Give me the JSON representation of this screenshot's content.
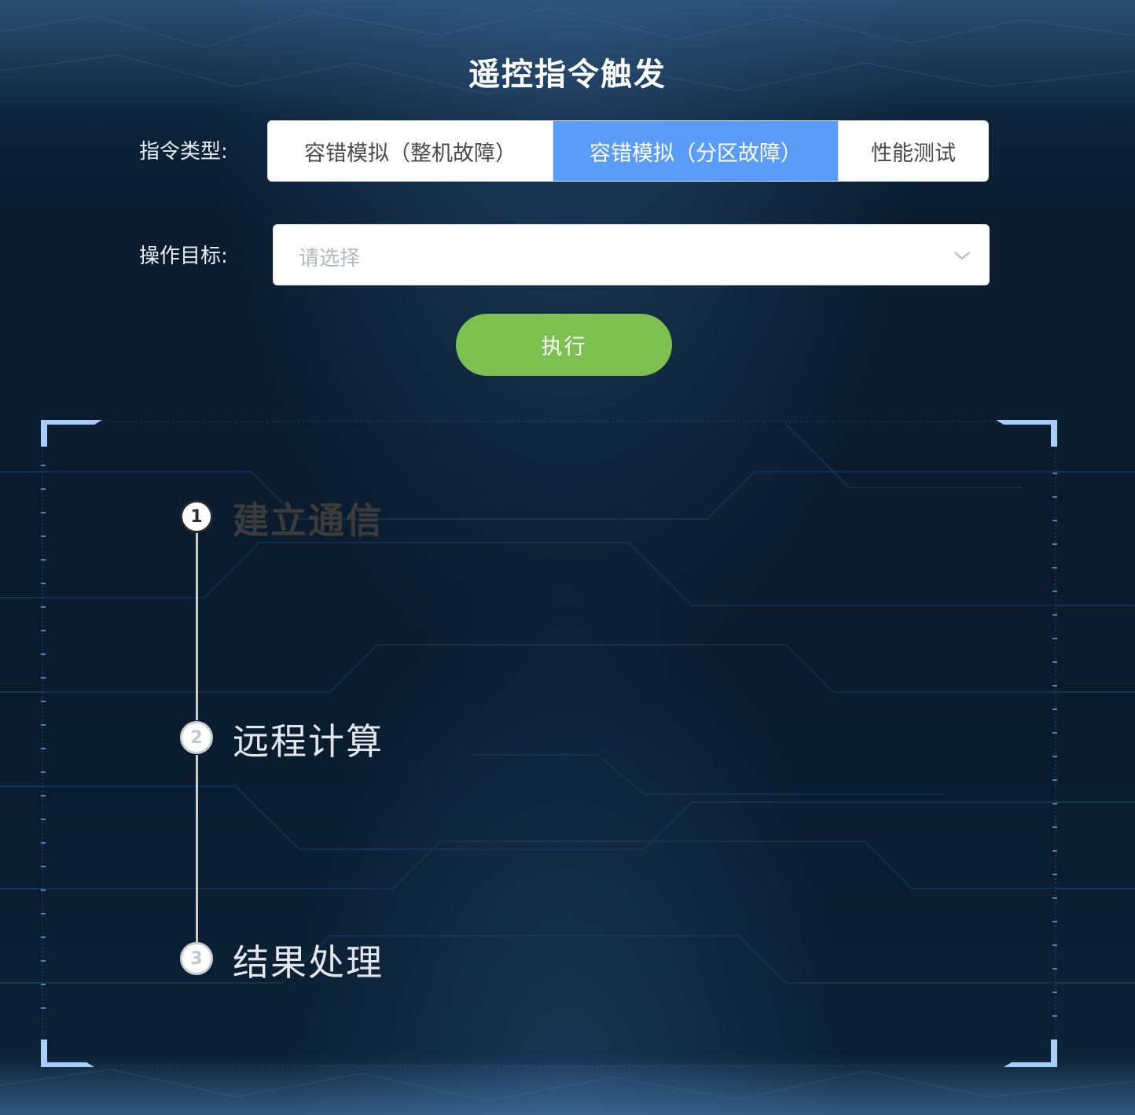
{
  "page": {
    "title": "遥控指令触发"
  },
  "form": {
    "command_type_label": "指令类型:",
    "command_types": [
      {
        "label": "容错模拟（整机故障）",
        "active": false
      },
      {
        "label": "容错模拟（分区故障）",
        "active": true
      },
      {
        "label": "性能测试",
        "active": false
      }
    ],
    "target_label": "操作目标:",
    "target_placeholder": "请选择",
    "target_value": "",
    "execute_label": "执行"
  },
  "steps": [
    {
      "number": "1",
      "title": "建立通信",
      "status": "done"
    },
    {
      "number": "2",
      "title": "远程计算",
      "status": "wait"
    },
    {
      "number": "3",
      "title": "结果处理",
      "status": "wait"
    }
  ],
  "colors": {
    "active_segment": "#5a9cf8",
    "execute_button": "#7cc14f",
    "frame_accent": "#6aa8ff",
    "background": "#0a1b2c"
  },
  "icons": {
    "select_arrow": "chevron-down-icon"
  }
}
